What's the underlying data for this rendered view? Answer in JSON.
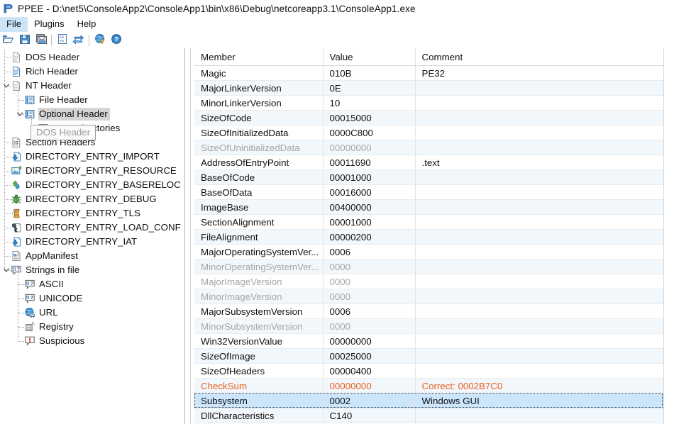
{
  "window": {
    "app_icon": "ppee-app-icon",
    "title": "PPEE - D:\\net5\\ConsoleApp2\\ConsoleApp1\\bin\\x86\\Debug\\netcoreapp3.1\\ConsoleApp1.exe"
  },
  "menubar": {
    "items": [
      {
        "label": "File",
        "active": true
      },
      {
        "label": "Plugins",
        "active": false
      },
      {
        "label": "Help",
        "active": false
      }
    ]
  },
  "toolbar": {
    "buttons": [
      {
        "name": "open-file-icon",
        "tip": "Open"
      },
      {
        "name": "save-icon",
        "tip": "Save"
      },
      {
        "name": "save-as-icon",
        "tip": "Save As"
      },
      {
        "name": "hex-editor-icon",
        "tip": "Hex"
      },
      {
        "name": "refresh-icon",
        "tip": "Refresh"
      },
      {
        "name": "virustotal-globe-icon",
        "tip": "VirusTotal"
      },
      {
        "name": "help-icon",
        "tip": "Help"
      }
    ]
  },
  "tooltip": {
    "text": "DOS Header"
  },
  "tree": {
    "items": [
      {
        "label": "DOS Header",
        "icon": "document-gray-icon",
        "indent": 1,
        "twist": "",
        "selected": false
      },
      {
        "label": "Rich Header",
        "icon": "document-blue-icon",
        "indent": 1,
        "twist": "",
        "selected": false
      },
      {
        "label": "NT Header",
        "icon": "document-gray-icon",
        "indent": 1,
        "twist": "down",
        "selected": false
      },
      {
        "label": "File Header",
        "icon": "table-blue-icon",
        "indent": 2,
        "twist": "",
        "selected": false
      },
      {
        "label": "Optional Header",
        "icon": "table-blue-icon",
        "indent": 2,
        "twist": "down",
        "selected": true
      },
      {
        "label": "Data Directories",
        "icon": "table-gray-icon",
        "indent": 3,
        "twist": "",
        "selected": false
      },
      {
        "label": "Section Headers",
        "icon": "section-doc-icon",
        "indent": 1,
        "twist": "",
        "selected": false
      },
      {
        "label": "DIRECTORY_ENTRY_IMPORT",
        "icon": "import-arrow-icon",
        "indent": 1,
        "twist": "",
        "selected": false
      },
      {
        "label": "DIRECTORY_ENTRY_RESOURCE",
        "icon": "resource-image-icon",
        "indent": 1,
        "twist": "",
        "selected": false
      },
      {
        "label": "DIRECTORY_ENTRY_BASERELOC",
        "icon": "reloc-recycle-icon",
        "indent": 1,
        "twist": "",
        "selected": false
      },
      {
        "label": "DIRECTORY_ENTRY_DEBUG",
        "icon": "debug-bug-icon",
        "indent": 1,
        "twist": "",
        "selected": false
      },
      {
        "label": "DIRECTORY_ENTRY_TLS",
        "icon": "tls-spool-icon",
        "indent": 1,
        "twist": "",
        "selected": false
      },
      {
        "label": "DIRECTORY_ENTRY_LOAD_CONFIG",
        "icon": "loadconfig-wrench-icon",
        "indent": 1,
        "twist": "",
        "selected": false
      },
      {
        "label": "DIRECTORY_ENTRY_IAT",
        "icon": "import-arrow-icon",
        "indent": 1,
        "twist": "",
        "selected": false
      },
      {
        "label": "AppManifest",
        "icon": "manifest-doc-icon",
        "indent": 1,
        "twist": "",
        "selected": false
      },
      {
        "label": "Strings in file",
        "icon": "strings-balloon-icon",
        "indent": 1,
        "twist": "down",
        "selected": false
      },
      {
        "label": "ASCII",
        "icon": "strings-balloon-icon",
        "indent": 2,
        "twist": "",
        "selected": false
      },
      {
        "label": "UNICODE",
        "icon": "strings-balloon-icon",
        "indent": 2,
        "twist": "",
        "selected": false
      },
      {
        "label": "URL",
        "icon": "url-globe-icon",
        "indent": 2,
        "twist": "",
        "selected": false
      },
      {
        "label": "Registry",
        "icon": "registry-icon",
        "indent": 2,
        "twist": "",
        "selected": false
      },
      {
        "label": "Suspicious",
        "icon": "suspicious-warning-icon",
        "indent": 2,
        "twist": "",
        "selected": false
      }
    ]
  },
  "table": {
    "columns": [
      "Member",
      "Value",
      "Comment"
    ],
    "rows": [
      {
        "member": "Magic",
        "value": "010B",
        "comment": "PE32",
        "state": "normal"
      },
      {
        "member": "MajorLinkerVersion",
        "value": "0E",
        "comment": "",
        "state": "normal"
      },
      {
        "member": "MinorLinkerVersion",
        "value": "10",
        "comment": "",
        "state": "normal"
      },
      {
        "member": "SizeOfCode",
        "value": "00015000",
        "comment": "",
        "state": "normal"
      },
      {
        "member": "SizeOfInitializedData",
        "value": "0000C800",
        "comment": "",
        "state": "normal"
      },
      {
        "member": "SizeOfUninitializedData",
        "value": "00000000",
        "comment": "",
        "state": "dim"
      },
      {
        "member": "AddressOfEntryPoint",
        "value": "00011690",
        "comment": ".text",
        "state": "normal"
      },
      {
        "member": "BaseOfCode",
        "value": "00001000",
        "comment": "",
        "state": "normal"
      },
      {
        "member": "BaseOfData",
        "value": "00016000",
        "comment": "",
        "state": "normal"
      },
      {
        "member": "ImageBase",
        "value": "00400000",
        "comment": "",
        "state": "normal"
      },
      {
        "member": "SectionAlignment",
        "value": "00001000",
        "comment": "",
        "state": "normal"
      },
      {
        "member": "FileAlignment",
        "value": "00000200",
        "comment": "",
        "state": "normal"
      },
      {
        "member": "MajorOperatingSystemVer...",
        "value": "0006",
        "comment": "",
        "state": "normal"
      },
      {
        "member": "MinorOperatingSystemVer...",
        "value": "0000",
        "comment": "",
        "state": "dim"
      },
      {
        "member": "MajorImageVersion",
        "value": "0000",
        "comment": "",
        "state": "dim"
      },
      {
        "member": "MinorImageVersion",
        "value": "0000",
        "comment": "",
        "state": "dim"
      },
      {
        "member": "MajorSubsystemVersion",
        "value": "0006",
        "comment": "",
        "state": "normal"
      },
      {
        "member": "MinorSubsystemVersion",
        "value": "0000",
        "comment": "",
        "state": "dim"
      },
      {
        "member": "Win32VersionValue",
        "value": "00000000",
        "comment": "",
        "state": "normal"
      },
      {
        "member": "SizeOfImage",
        "value": "00025000",
        "comment": "",
        "state": "normal"
      },
      {
        "member": "SizeOfHeaders",
        "value": "00000400",
        "comment": "",
        "state": "normal"
      },
      {
        "member": "CheckSum",
        "value": "00000000",
        "comment": "Correct: 0002B7C0",
        "state": "warn"
      },
      {
        "member": "Subsystem",
        "value": "0002",
        "comment": "Windows GUI",
        "state": "selected"
      },
      {
        "member": "DllCharacteristics",
        "value": "C140",
        "comment": "",
        "state": "normal"
      }
    ]
  },
  "annotation": {
    "arrow_color": "#e8352a",
    "arrow_target": "Windows GUI"
  },
  "colors": {
    "selection_row": "#cbe5fb",
    "alt_row": "#f2f7fb",
    "warn_text": "#e8601c",
    "dim_text": "#a6a6a6",
    "menu_highlight": "#cce4f7"
  }
}
